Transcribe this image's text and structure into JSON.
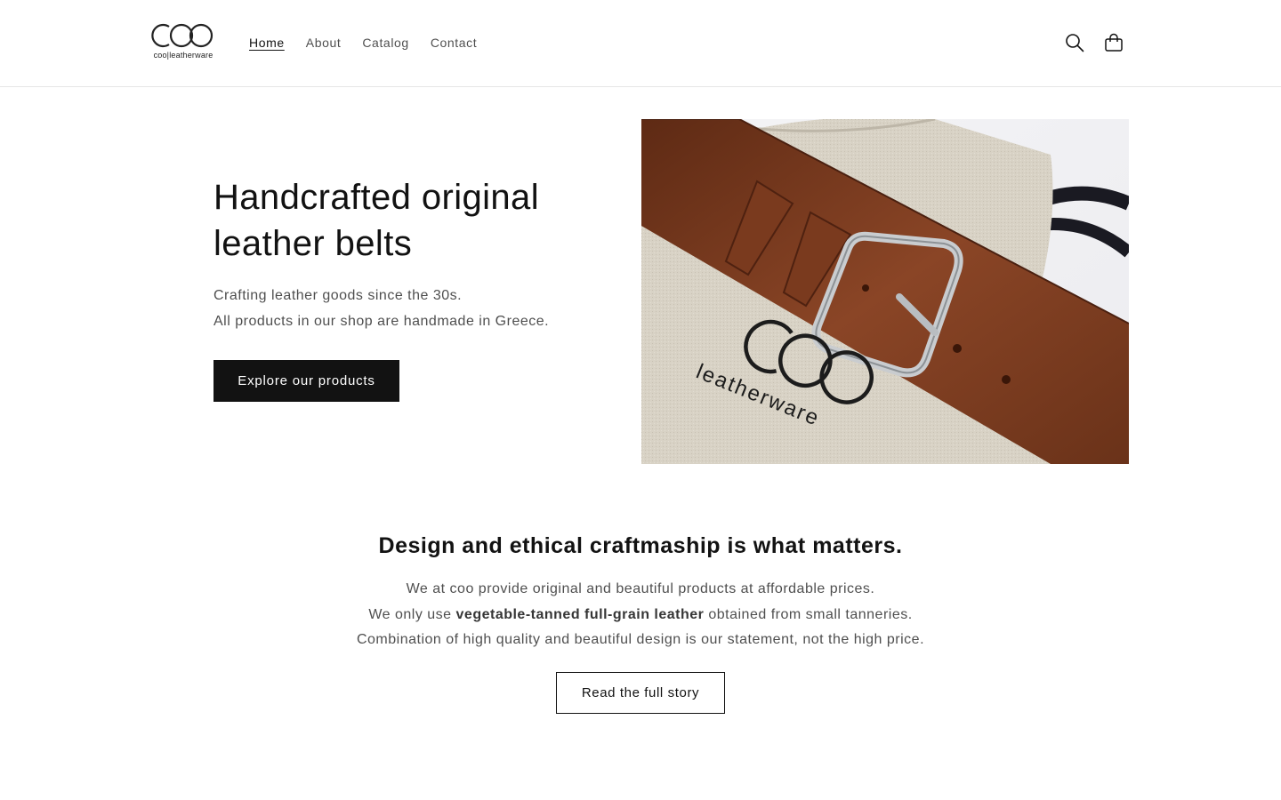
{
  "header": {
    "logo_text": "coo|leatherware",
    "nav": [
      {
        "label": "Home",
        "active": true
      },
      {
        "label": "About",
        "active": false
      },
      {
        "label": "Catalog",
        "active": false
      },
      {
        "label": "Contact",
        "active": false
      }
    ],
    "icons": [
      "search-icon",
      "cart-icon"
    ]
  },
  "hero": {
    "title": "Handcrafted original leather belts",
    "subtitle_line1": "Crafting leather goods since the 30s.",
    "subtitle_line2": "All products in our shop are handmade in Greece.",
    "button_label": "Explore our products",
    "image": {
      "pouch_brand": "COO",
      "pouch_text": "leatherware",
      "colors": {
        "leather": "#7a3a1e",
        "linen": "#d9d3c7",
        "buckle": "#c9cccf",
        "cord": "#1a1a22"
      }
    }
  },
  "story": {
    "title": "Design and ethical craftmaship is what matters.",
    "line1": "We at coo provide original and beautiful products at affordable prices.",
    "line2_pre": "We only use ",
    "line2_bold": "vegetable-tanned full-grain leather",
    "line2_post": " obtained from small tanneries.",
    "line3": "Combination of high quality and beautiful design is our statement, not the high price.",
    "button_label": "Read the full story"
  },
  "colors": {
    "text": "#121212",
    "button_bg": "#121212",
    "button_text": "#ffffff",
    "border": "#e6e6e6"
  }
}
